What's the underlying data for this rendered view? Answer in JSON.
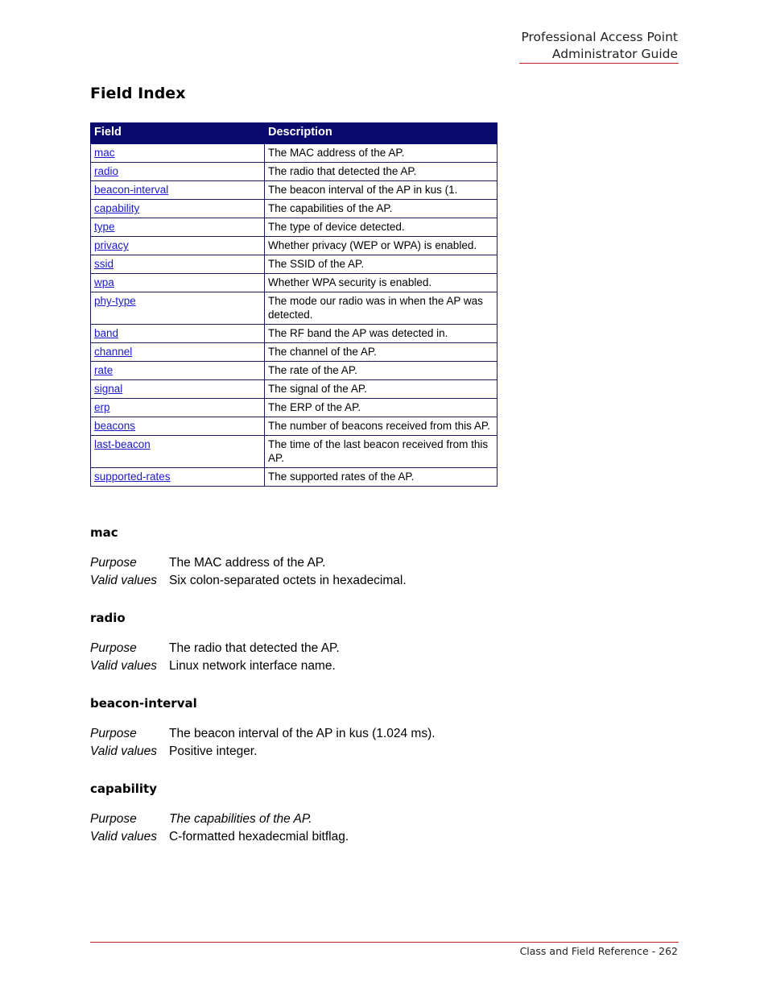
{
  "header": {
    "line1": "Professional Access Point",
    "line2": "Administrator Guide"
  },
  "page_title": "Field Index",
  "table": {
    "headers": [
      "Field",
      "Description"
    ],
    "rows": [
      {
        "field": "mac",
        "description": "The MAC address of the AP."
      },
      {
        "field": "radio",
        "description": "The radio that detected the AP."
      },
      {
        "field": "beacon-interval",
        "description": "The beacon interval of the AP in kus (1."
      },
      {
        "field": "capability",
        "description": "The capabilities of the AP."
      },
      {
        "field": "type",
        "description": "The type of device detected."
      },
      {
        "field": "privacy",
        "description": "Whether privacy (WEP or WPA) is enabled."
      },
      {
        "field": "ssid",
        "description": "The SSID of the AP."
      },
      {
        "field": "wpa",
        "description": "Whether WPA security is enabled."
      },
      {
        "field": "phy-type",
        "description": "The mode our radio was in when the AP was detected."
      },
      {
        "field": "band",
        "description": "The RF band the AP was detected in."
      },
      {
        "field": "channel",
        "description": "The channel of the AP."
      },
      {
        "field": "rate",
        "description": "The rate of the AP."
      },
      {
        "field": "signal",
        "description": "The signal of the AP."
      },
      {
        "field": "erp",
        "description": "The ERP of the AP."
      },
      {
        "field": "beacons",
        "description": "The number of beacons received from this AP."
      },
      {
        "field": "last-beacon",
        "description": "The time of the last beacon received from this AP."
      },
      {
        "field": "supported-rates",
        "description": "The supported rates of the AP."
      }
    ]
  },
  "labels": {
    "purpose": "Purpose",
    "valid_values": "Valid values"
  },
  "sections": [
    {
      "name": "mac",
      "purpose": "The MAC address of the AP.",
      "valid_values": "Six colon-separated octets in hexadecimal."
    },
    {
      "name": "radio",
      "purpose": "The radio that detected the AP.",
      "valid_values": "Linux network interface name."
    },
    {
      "name": "beacon-interval",
      "purpose": "The beacon interval of the AP in kus (1.024 ms).",
      "valid_values": "Positive integer."
    },
    {
      "name": "capability",
      "purpose": "The capabilities of the AP.",
      "valid_values": "C-formatted hexadecmial bitflag."
    }
  ],
  "footer": {
    "text": "Class and Field Reference - 262"
  },
  "colors": {
    "header_rule": "#d62020",
    "table_header_bg": "#0a0a6e",
    "link": "#1a1acc"
  }
}
